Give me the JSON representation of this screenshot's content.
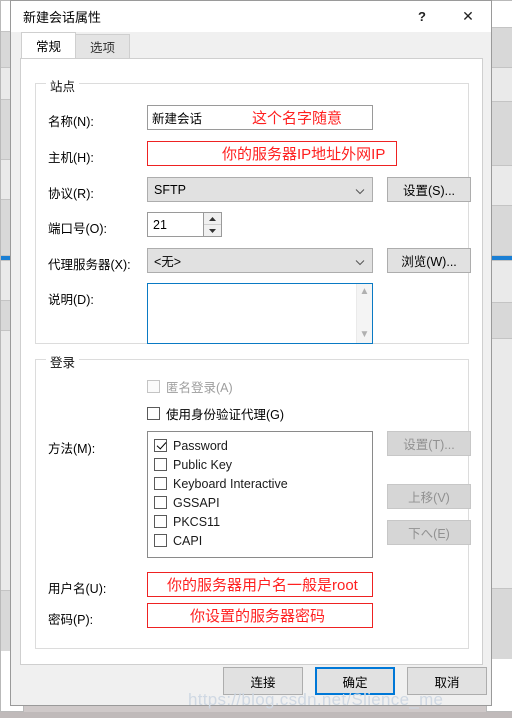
{
  "window": {
    "title": "新建会话属性",
    "help_icon": "question-mark-icon",
    "close_icon": "close-icon"
  },
  "tabs": [
    {
      "label": "常规",
      "active": true
    },
    {
      "label": "选项",
      "active": false
    }
  ],
  "site_group": {
    "title": "站点",
    "name": {
      "label": "名称(N):",
      "value": "新建会话",
      "annotation": "这个名字随意"
    },
    "host": {
      "label": "主机(H):",
      "value": "",
      "annotation": "你的服务器IP地址外网IP"
    },
    "protocol": {
      "label": "协议(R):",
      "value": "SFTP",
      "button": "设置(S)..."
    },
    "port": {
      "label": "端口号(O):",
      "value": "21"
    },
    "proxy": {
      "label": "代理服务器(X):",
      "value": "<无>",
      "button": "浏览(W)..."
    },
    "description": {
      "label": "说明(D):",
      "value": ""
    }
  },
  "login_group": {
    "title": "登录",
    "anonymous": {
      "label": "匿名登录(A)",
      "checked": false,
      "disabled": true
    },
    "auth_agent": {
      "label": "使用身份验证代理(G)",
      "checked": false,
      "disabled": false
    },
    "method": {
      "label": "方法(M):",
      "items": [
        {
          "label": "Password",
          "checked": true
        },
        {
          "label": "Public Key",
          "checked": false
        },
        {
          "label": "Keyboard Interactive",
          "checked": false
        },
        {
          "label": "GSSAPI",
          "checked": false
        },
        {
          "label": "PKCS11",
          "checked": false
        },
        {
          "label": "CAPI",
          "checked": false
        }
      ]
    },
    "method_buttons": [
      {
        "label": "设置(T)...",
        "disabled": true
      },
      {
        "label": "上移(V)",
        "disabled": true
      },
      {
        "label": "下へ(E)",
        "disabled": true
      }
    ],
    "username": {
      "label": "用户名(U):",
      "value": "",
      "annotation": "你的服务器用户名一般是root"
    },
    "password": {
      "label": "密码(P):",
      "value": "",
      "annotation": "你设置的服务器密码"
    }
  },
  "footer_buttons": [
    {
      "label": "连接",
      "default": false
    },
    {
      "label": "确定",
      "default": true
    },
    {
      "label": "取消",
      "default": false
    }
  ],
  "watermark": "https://blog.csdn.net/Slience_me",
  "colors": {
    "accent": "#0078d7",
    "annotation": "#ff2020",
    "dialog_bg": "#f0f0f0",
    "page_bg": "#ffffff"
  }
}
